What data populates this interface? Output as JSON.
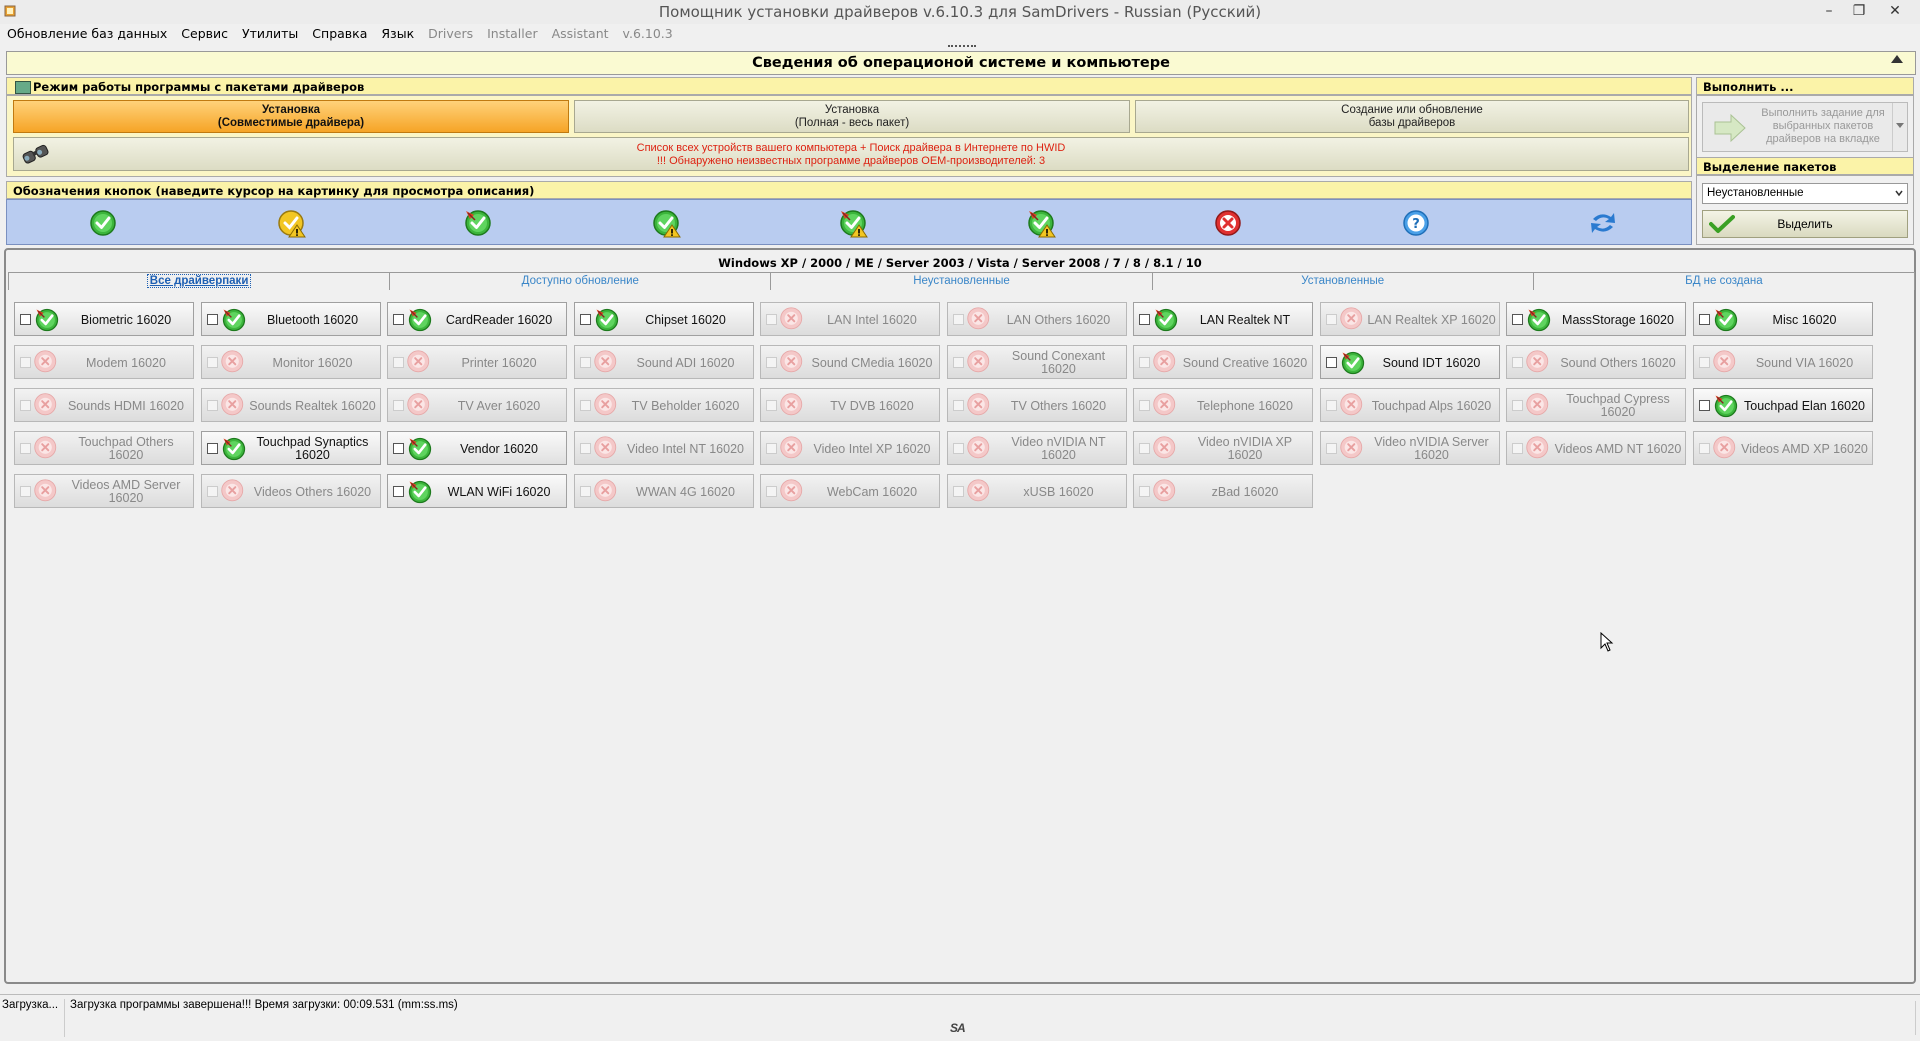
{
  "window": {
    "title": "Помощник установки драйверов v.6.10.3 для SamDrivers - Russian (Русский)",
    "minimize": "–",
    "maximize": "❐",
    "close": "✕"
  },
  "menu": [
    {
      "label": "Обновление баз данных",
      "enabled": true
    },
    {
      "label": "Сервис",
      "enabled": true
    },
    {
      "label": "Утилиты",
      "enabled": true
    },
    {
      "label": "Справка",
      "enabled": true
    },
    {
      "label": "Язык",
      "enabled": true
    },
    {
      "label": "Drivers",
      "enabled": false
    },
    {
      "label": "Installer",
      "enabled": false
    },
    {
      "label": "Assistant",
      "enabled": false
    },
    {
      "label": "v.6.10.3",
      "enabled": false
    }
  ],
  "os_header": "Сведения об операционой системе и компьютере",
  "mode_panel": {
    "title": "Режим работы программы с пакетами драйверов",
    "buttons": [
      {
        "line1": "Установка",
        "line2": "(Совместимые драйвера)",
        "active": true
      },
      {
        "line1": "Установка",
        "line2": "(Полная - весь пакет)",
        "active": false
      },
      {
        "line1": "Создание или обновление",
        "line2": "базы драйверов",
        "active": false
      }
    ],
    "hwid_line1": "Список всех устройств вашего компьютера + Поиск драйвера в Интернете по HWID",
    "hwid_line2": "!!! Обнаружено неизвестных программе драйверов OEM-производителей: 3"
  },
  "legend": {
    "title": "Обозначения кнопок (наведите курсор на картинку для просмотра описания)",
    "icons": [
      "check-ok-icon",
      "check-warning-icon",
      "check-pin-icon",
      "check-pin-warning-icon",
      "check-pin-warning-red-icon",
      "check-pin-warning-yellow-icon",
      "cross-error-icon",
      "question-help-icon",
      "refresh-arrows-icon"
    ]
  },
  "execute": {
    "title": "Выполнить ...",
    "button_text": "Выполнить задание для выбранных пакетов драйверов на вкладке"
  },
  "selection": {
    "title": "Выделение пакетов драйверов:",
    "selected_option": "Неустановленные",
    "button_label": "Выделить"
  },
  "os_list": "Windows XP / 2000 / ME / Server 2003 / Vista / Server 2008 / 7 / 8 / 8.1 / 10",
  "tabs": [
    {
      "label": "Все драйверпаки",
      "active": true
    },
    {
      "label": "Доступно обновление",
      "active": false
    },
    {
      "label": "Неустановленные",
      "active": false
    },
    {
      "label": "Установленные",
      "active": false
    },
    {
      "label": "БД не создана",
      "active": false
    }
  ],
  "packs": [
    {
      "label": "Biometric 16020",
      "status": "ok"
    },
    {
      "label": "Bluetooth 16020",
      "status": "ok"
    },
    {
      "label": "CardReader 16020",
      "status": "ok"
    },
    {
      "label": "Chipset 16020",
      "status": "ok"
    },
    {
      "label": "LAN Intel 16020",
      "status": "no"
    },
    {
      "label": "LAN Others 16020",
      "status": "no"
    },
    {
      "label": "LAN Realtek NT",
      "status": "ok"
    },
    {
      "label": "LAN Realtek XP 16020",
      "status": "no"
    },
    {
      "label": "MassStorage 16020",
      "status": "ok"
    },
    {
      "label": "Misc 16020",
      "status": "ok"
    },
    {
      "label": "Modem 16020",
      "status": "no"
    },
    {
      "label": "Monitor 16020",
      "status": "no"
    },
    {
      "label": "Printer 16020",
      "status": "no"
    },
    {
      "label": "Sound ADI 16020",
      "status": "no"
    },
    {
      "label": "Sound CMedia 16020",
      "status": "no"
    },
    {
      "label": "Sound Conexant 16020",
      "status": "no"
    },
    {
      "label": "Sound Creative 16020",
      "status": "no"
    },
    {
      "label": "Sound IDT 16020",
      "status": "ok"
    },
    {
      "label": "Sound Others 16020",
      "status": "no"
    },
    {
      "label": "Sound VIA 16020",
      "status": "no"
    },
    {
      "label": "Sounds HDMI 16020",
      "status": "no"
    },
    {
      "label": "Sounds Realtek 16020",
      "status": "no"
    },
    {
      "label": "TV Aver 16020",
      "status": "no"
    },
    {
      "label": "TV Beholder 16020",
      "status": "no"
    },
    {
      "label": "TV DVB 16020",
      "status": "no"
    },
    {
      "label": "TV Others 16020",
      "status": "no"
    },
    {
      "label": "Telephone 16020",
      "status": "no"
    },
    {
      "label": "Touchpad Alps 16020",
      "status": "no"
    },
    {
      "label": "Touchpad Cypress 16020",
      "status": "no"
    },
    {
      "label": "Touchpad Elan 16020",
      "status": "ok"
    },
    {
      "label": "Touchpad Others 16020",
      "status": "no"
    },
    {
      "label": "Touchpad Synaptics 16020",
      "status": "ok"
    },
    {
      "label": "Vendor 16020",
      "status": "ok"
    },
    {
      "label": "Video Intel NT 16020",
      "status": "no"
    },
    {
      "label": "Video Intel XP 16020",
      "status": "no"
    },
    {
      "label": "Video nVIDIA NT 16020",
      "status": "no"
    },
    {
      "label": "Video nVIDIA XP 16020",
      "status": "no"
    },
    {
      "label": "Video nVIDIA Server 16020",
      "status": "no"
    },
    {
      "label": "Videos AMD NT 16020",
      "status": "no"
    },
    {
      "label": "Videos AMD XP 16020",
      "status": "no"
    },
    {
      "label": "Videos AMD Server 16020",
      "status": "no"
    },
    {
      "label": "Videos Others 16020",
      "status": "no"
    },
    {
      "label": "WLAN WiFi 16020",
      "status": "ok"
    },
    {
      "label": "WWAN 4G 16020",
      "status": "no"
    },
    {
      "label": "WebCam 16020",
      "status": "no"
    },
    {
      "label": "xUSB 16020",
      "status": "no"
    },
    {
      "label": "zBad 16020",
      "status": "no"
    }
  ],
  "status": {
    "left": "Загрузка...",
    "message": "Загрузка программы завершена!!! Время загрузки: 00:09.531 (mm:ss.ms)",
    "logo": "SA"
  }
}
